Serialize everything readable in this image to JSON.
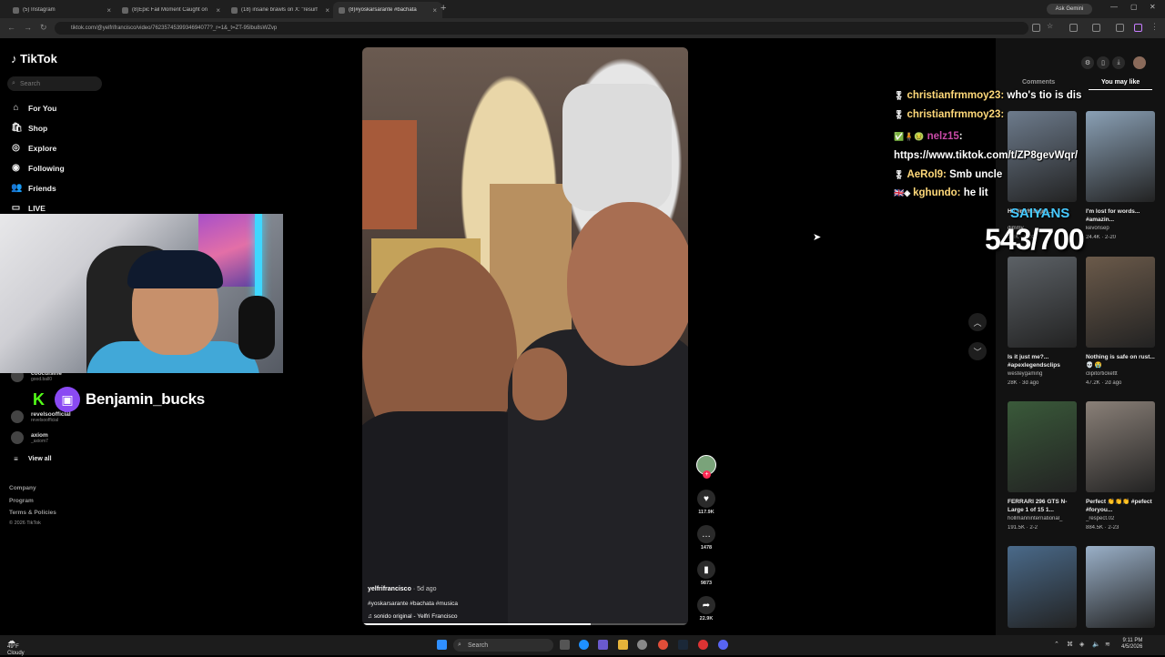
{
  "browser": {
    "tabs": [
      {
        "title": "(5) Instagram"
      },
      {
        "title": "(8)Epic Fail Moment Caught on"
      },
      {
        "title": "(18) insane brawls on X: \"resurf"
      },
      {
        "title": "(8)#yoskarsarante #bachata"
      }
    ],
    "new_tab": "+",
    "ask_gemini": "Ask Gemini",
    "url": "tiktok.com/@yelfrifrancisco/video/7623574539934694077?_r=1&_t=ZT-95lbu8sWZvp"
  },
  "sidebar": {
    "logo": "TikTok",
    "search_placeholder": "Search",
    "nav": [
      {
        "label": "For You",
        "icon": "home-icon"
      },
      {
        "label": "Shop",
        "icon": "shop-icon"
      },
      {
        "label": "Explore",
        "icon": "compass-icon"
      },
      {
        "label": "Following",
        "icon": "following-icon"
      },
      {
        "label": "Friends",
        "icon": "friends-icon"
      },
      {
        "label": "LIVE",
        "icon": "live-icon"
      }
    ],
    "accounts": [
      {
        "name": "coocuisine",
        "handle": "good.ball0"
      },
      {
        "name": "kick",
        "handle": ""
      },
      {
        "name": "revelsoofficial",
        "handle": "revelsoofficial"
      },
      {
        "name": "axiom",
        "handle": "_axiom7"
      }
    ],
    "view_all": "View all",
    "footer": [
      "Company",
      "Program",
      "Terms & Policies"
    ],
    "copyright": "© 2026 TikTok"
  },
  "stream_overlay": {
    "twitch_name": "Benjamin_bucks",
    "counter_label": "SAIYANS",
    "counter": "543/700"
  },
  "chat": [
    {
      "user": "christianfrmmoy23:",
      "text": "who's tio is dis"
    },
    {
      "user": "christianfrmmoy23:",
      "text": ""
    },
    {
      "user": "nelz15",
      "text": ":"
    },
    {
      "user": "",
      "text": "https://www.tiktok.com/t/ZP8gevWqr/"
    },
    {
      "user": "AeRol9:",
      "text": "Smb uncle"
    },
    {
      "user": "kghundo:",
      "text": "he lit"
    }
  ],
  "video": {
    "username": "yelfrifrancisco",
    "age": "· 5d ago",
    "tags": "#yoskarsarante #bachata #musica",
    "sound": "sonido original - Yelfri Francisco",
    "progress": 0.7,
    "actions": {
      "likes": "117.9K",
      "comments": "1478",
      "saves": "9873",
      "shares": "22.9K"
    }
  },
  "right_panel": {
    "tabs": [
      "Comments",
      "You may like"
    ],
    "active_tab": "You may like",
    "items": [
      {
        "caption": "Ha #mrhungry...",
        "author": "dimmy",
        "stats": "1.3K · 2-20",
        "color": "#6d7b8c"
      },
      {
        "caption": "I'm lost for words... #amazin...",
        "author": "kevonsep",
        "stats": "24.4K · 2-20",
        "color": "#8aa0b5"
      },
      {
        "caption": "Is it just me?... #apexlegendsclips",
        "author": "westeygaming",
        "stats": "28K · 3d ago",
        "color": "#5c6166"
      },
      {
        "caption": "Nothing is safe on rust... 💀 😭",
        "author": "clipitortickettt",
        "stats": "47.2K · 2d ago",
        "color": "#6b5a4a"
      },
      {
        "caption": "FERRARI 296 GTS N-Large 1 of 15 1...",
        "author": "hollmanninternational_",
        "stats": "191.5K · 2-2",
        "color": "#3a5a3a"
      },
      {
        "caption": "Perfect 👏👏👏 #pefect #foryou...",
        "author": "_respect.02",
        "stats": "884.5K · 2-23",
        "color": "#8a8078"
      },
      {
        "caption": "",
        "author": "",
        "stats": "",
        "color": "#4a6a8a"
      },
      {
        "caption": "",
        "author": "",
        "stats": "",
        "color": "#9ab0c8"
      }
    ]
  },
  "taskbar": {
    "weather_temp": "49°F",
    "weather_desc": "Cloudy",
    "search": "Search",
    "time": "9:11 PM",
    "date": "4/5/2026"
  }
}
